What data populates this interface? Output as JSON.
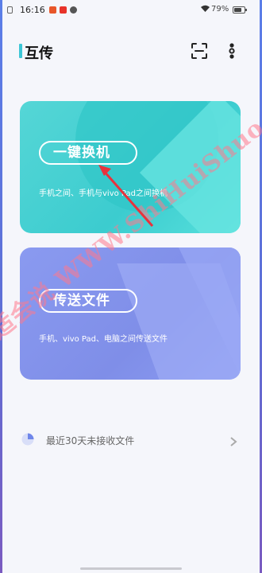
{
  "status_bar": {
    "time": "16:16",
    "battery": "79%",
    "battery_level": 0.79
  },
  "header": {
    "title": "互传",
    "scan_icon": "scan-icon",
    "more_icon": "more-vertical-icon"
  },
  "cards": [
    {
      "button_label": "一键换机",
      "description": "手机之间、手机与vivo Pad之间换机",
      "color": "#47d2d3"
    },
    {
      "button_label": "传送文件",
      "description": "手机、vivo Pad、电脑之间传送文件",
      "color": "#8393ec"
    }
  ],
  "recent": {
    "label": "最近30天未接收文件",
    "icon": "pie-icon",
    "chevron": "chevron-right-icon"
  },
  "watermark": "适会说 WWW.ShiHuiShuo.Com",
  "colors": {
    "accent": "#3cc6d6",
    "arrow": "#e8323c",
    "watermark": "#ff788c"
  }
}
